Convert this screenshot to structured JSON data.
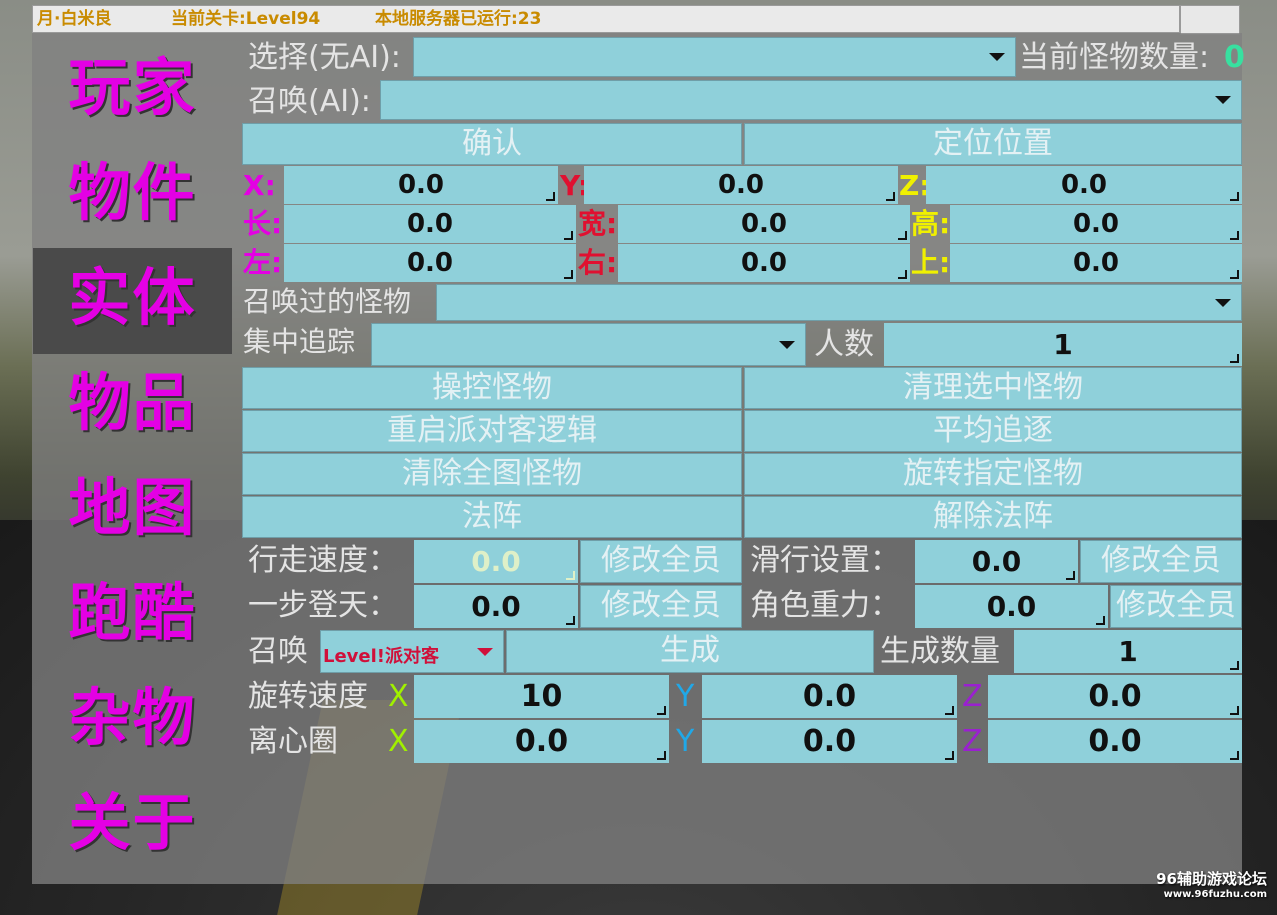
{
  "topbar": {
    "player": "月·白米良",
    "level": "当前关卡:Level94",
    "server": "本地服务器已运行:23"
  },
  "sidebar": {
    "items": [
      {
        "label": "玩家",
        "active": false
      },
      {
        "label": "物件",
        "active": false
      },
      {
        "label": "实体",
        "active": true
      },
      {
        "label": "物品",
        "active": false
      },
      {
        "label": "地图",
        "active": false
      },
      {
        "label": "跑酷",
        "active": false
      },
      {
        "label": "杂物",
        "active": false
      },
      {
        "label": "关于",
        "active": false
      }
    ]
  },
  "main": {
    "select_label": "选择(无AI):",
    "select_value": "",
    "monster_count_label": "当前怪物数量:",
    "monster_count": "0",
    "summon_label": "召唤(AI):",
    "summon_value": "",
    "confirm": "确认",
    "locate": "定位位置",
    "coords": {
      "x_label": "X:",
      "x": "0.0",
      "y_label": "Y:",
      "y": "0.0",
      "z_label": "Z:",
      "z": "0.0",
      "len_label": "长:",
      "len": "0.0",
      "wid_label": "宽:",
      "wid": "0.0",
      "hei_label": "高:",
      "hei": "0.0",
      "left_label": "左:",
      "left": "0.0",
      "right_label": "右:",
      "right": "0.0",
      "up_label": "上:",
      "up": "0.0"
    },
    "summoned_label": "召唤过的怪物",
    "summoned_value": "",
    "focus_label": "集中追踪",
    "focus_value": "",
    "people_label": "人数",
    "people": "1",
    "buttons": {
      "control": "操控怪物",
      "clear_selected": "清理选中怪物",
      "restart_logic": "重启派对客逻辑",
      "even_chase": "平均追逐",
      "clear_all": "清除全图怪物",
      "rotate_selected": "旋转指定怪物",
      "array": "法阵",
      "remove_array": "解除法阵"
    },
    "walk_speed_label": "行走速度：",
    "walk_speed": "0.0",
    "modify_all_1": "修改全员",
    "slide_label": "滑行设置：",
    "slide": "0.0",
    "modify_all_2": "修改全员",
    "step_label": "一步登天：",
    "step": "0.0",
    "modify_all_3": "修改全员",
    "gravity_label": "角色重力：",
    "gravity": "0.0",
    "modify_all_4": "修改全员",
    "summon2_label": "召唤",
    "summon2_value": "Level!派对客",
    "generate": "生成",
    "gen_count_label": "生成数量",
    "gen_count": "1",
    "rot_label": "旋转速度",
    "rot_x_label": "X",
    "rot_x": "10",
    "rot_y_label": "Y",
    "rot_y": "0.0",
    "rot_z_label": "Z",
    "rot_z": "0.0",
    "orbit_label": "离心圈",
    "orb_x_label": "X",
    "orb_x": "0.0",
    "orb_y_label": "Y",
    "orb_y": "0.0",
    "orb_z_label": "Z",
    "orb_z": "0.0"
  },
  "watermark": {
    "line1": "96辅助游戏论坛",
    "line2": "www.96fuzhu.com"
  },
  "colors": {
    "accent_magenta": "#e400e4",
    "field_blue": "#8fd0da",
    "count_green": "#38e0a0",
    "label_yellow": "#f0f000",
    "label_red": "#e01030",
    "label_purple": "#9a20d0",
    "label_cyan": "#20a8e8",
    "label_lime": "#a0f000"
  }
}
